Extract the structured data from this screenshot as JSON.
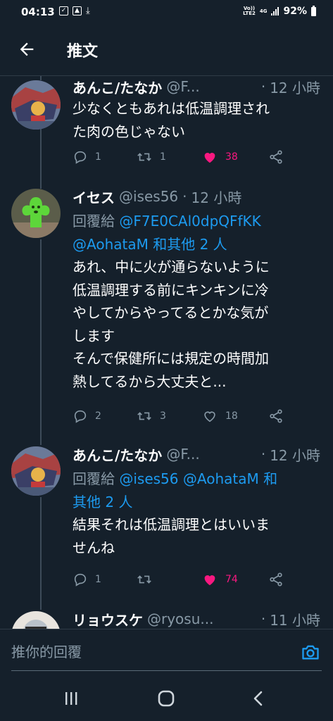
{
  "status": {
    "time": "04:13",
    "left_icons": [
      "notification-check-icon",
      "image-icon",
      "download-done-icon"
    ],
    "volte_top": "Vo))",
    "volte_bottom": "LTE2",
    "network": "4G",
    "battery": "92%"
  },
  "header": {
    "title": "推文",
    "back_icon": "arrow-left-icon"
  },
  "tweets": [
    {
      "name": "あんこ/たなか",
      "handle": "@F...",
      "time": "12 小時",
      "lines": [
        "少なくともあれは低温調理され",
        "た肉の色じゃない"
      ],
      "replies": "1",
      "retweets": "1",
      "likes": "38",
      "liked": true
    },
    {
      "name": "イセス",
      "handle": "@ises56",
      "time": "12 小時",
      "reply_prefix": "回覆給",
      "reply_handle1": "@F7E0CAl0dpQFfKK",
      "reply_handle2": "@AohataM",
      "reply_suffix": "和其他 2 人",
      "lines": [
        "あれ、中に火が通らないように",
        "低温調理する前にキンキンに冷",
        "やしてからやってるとかな気が",
        "します",
        "そんで保健所には規定の時間加",
        "熱してるから大丈夫と..."
      ],
      "replies": "2",
      "retweets": "3",
      "likes": "18",
      "liked": false
    },
    {
      "name": "あんこ/たなか",
      "handle": "@F...",
      "time": "12 小時",
      "reply_prefix": "回覆給",
      "reply_handle1": "@ises56",
      "reply_handle2": "@AohataM",
      "reply_suffix_a": "和",
      "reply_suffix_b": "其他 2 人",
      "lines": [
        "結果それは低温調理とはいいま",
        "せんね"
      ],
      "replies": "1",
      "retweets": "",
      "likes": "74",
      "liked": true
    },
    {
      "name": "リョウスケ",
      "handle": "@ryosu...",
      "time": "11 小時"
    }
  ],
  "reply_bar": {
    "placeholder": "推你的回覆",
    "camera_icon": "camera-icon"
  },
  "nav": {
    "recents": "recents-icon",
    "home": "home-icon",
    "back": "nav-back-icon"
  },
  "colors": {
    "background": "#15202b",
    "link": "#1d9bf0",
    "like": "#f91880",
    "muted": "#8899a6"
  }
}
